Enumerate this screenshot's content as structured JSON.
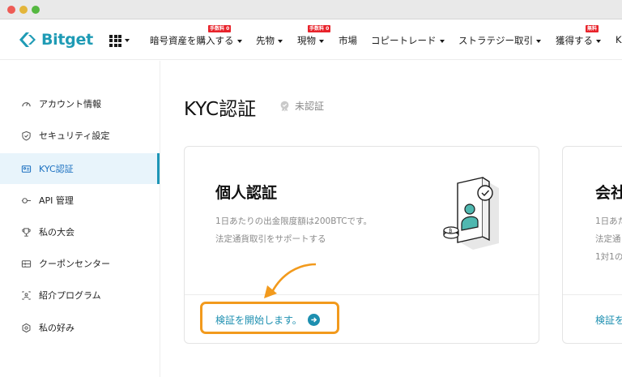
{
  "brand": {
    "name": "Bitget",
    "accent": "#1d95b6",
    "highlight": "#f29a1d"
  },
  "nav": {
    "items": [
      {
        "label": "暗号資産を購入する",
        "badge": "手数料 0",
        "has_caret": true
      },
      {
        "label": "先物",
        "has_caret": true
      },
      {
        "label": "現物",
        "badge": "手数料 0",
        "has_caret": true
      },
      {
        "label": "市場",
        "has_caret": false
      },
      {
        "label": "コピートレード",
        "has_caret": true
      },
      {
        "label": "ストラテジー取引",
        "has_caret": true
      },
      {
        "label": "獲得する",
        "badge": "無料",
        "has_caret": true
      },
      {
        "label": "K",
        "has_caret": false
      }
    ]
  },
  "sidebar": {
    "items": [
      {
        "label": "アカウント情報",
        "icon": "gauge-icon",
        "active": false
      },
      {
        "label": "セキュリティ設定",
        "icon": "shield-icon",
        "active": false
      },
      {
        "label": "KYC認証",
        "icon": "id-card-icon",
        "active": true
      },
      {
        "label": "API 管理",
        "icon": "api-icon",
        "active": false
      },
      {
        "label": "私の大会",
        "icon": "trophy-icon",
        "active": false
      },
      {
        "label": "クーポンセンター",
        "icon": "coupon-icon",
        "active": false
      },
      {
        "label": "紹介プログラム",
        "icon": "referral-icon",
        "active": false
      },
      {
        "label": "私の好み",
        "icon": "settings-icon",
        "active": false
      }
    ]
  },
  "main": {
    "title": "KYC認証",
    "status": "未認証",
    "cards": [
      {
        "title": "個人認証",
        "desc_1": "1日あたりの出金限度額は200BTCです。",
        "desc_2": "法定通貨取引をサポートする",
        "action": "検証を開始します。"
      },
      {
        "title": "会社",
        "desc_1": "1日あた",
        "desc_2": "法定通",
        "desc_3": "1対1の",
        "action": "検証を"
      }
    ]
  }
}
